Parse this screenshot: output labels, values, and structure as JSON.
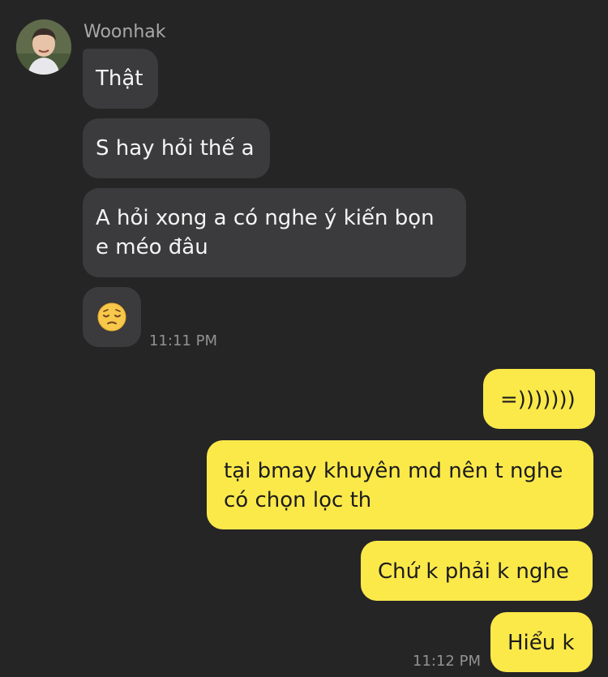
{
  "contact": {
    "name": "Woonhak",
    "avatar": "avatar-photo"
  },
  "messages": {
    "m1": "Thật",
    "m2": "S hay hỏi thế a",
    "m3": "A hỏi xong a có nghe ý kiến bọn e méo đâu",
    "m4_icon": "pensive-face-emoji",
    "m5": "=)))))))",
    "m6": "tại bmay khuyên md nên t nghe có chọn lọc th",
    "m7": "Chứ k phải k nghe",
    "m8": "Hiểu k"
  },
  "timestamps": {
    "incoming": "11:11 PM",
    "outgoing": "11:12 PM"
  },
  "colors": {
    "background": "#252526",
    "incoming_bubble": "#3b3b3d",
    "outgoing_bubble": "#fbe94a",
    "timestamp": "#929294"
  }
}
